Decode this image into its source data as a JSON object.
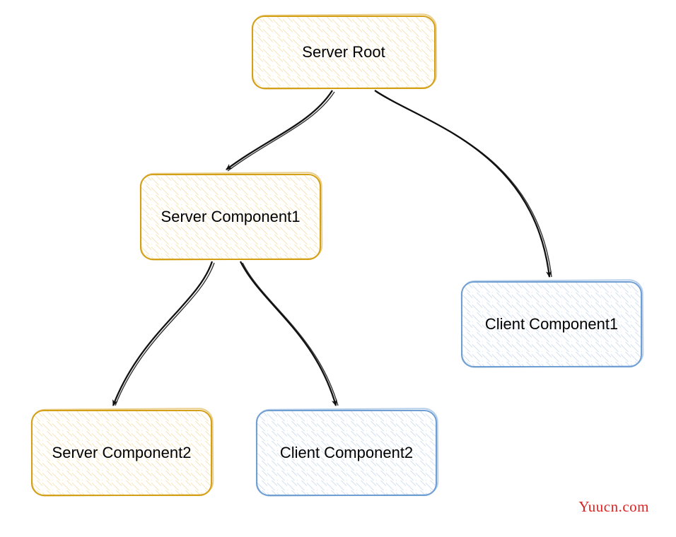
{
  "chart_data": {
    "type": "tree",
    "nodes": [
      {
        "id": "root",
        "label": "Server Root",
        "kind": "server"
      },
      {
        "id": "sc1",
        "label": "Server Component1",
        "kind": "server"
      },
      {
        "id": "cc1",
        "label": "Client Component1",
        "kind": "client"
      },
      {
        "id": "sc2",
        "label": "Server Component2",
        "kind": "server"
      },
      {
        "id": "cc2",
        "label": "Client Component2",
        "kind": "client"
      }
    ],
    "edges": [
      {
        "from": "root",
        "to": "sc1"
      },
      {
        "from": "root",
        "to": "cc1"
      },
      {
        "from": "sc1",
        "to": "sc2"
      },
      {
        "from": "sc1",
        "to": "cc2"
      }
    ],
    "palette": {
      "server_border": "#d4a017",
      "client_border": "#6f9fd3",
      "arrow": "#111111"
    }
  },
  "nodes": {
    "root": {
      "label": "Server Root"
    },
    "sc1": {
      "label": "Server Component1"
    },
    "cc1": {
      "label": "Client Component1"
    },
    "sc2": {
      "label": "Server Component2"
    },
    "cc2": {
      "label": "Client Component2"
    }
  },
  "watermark": "Yuucn.com"
}
